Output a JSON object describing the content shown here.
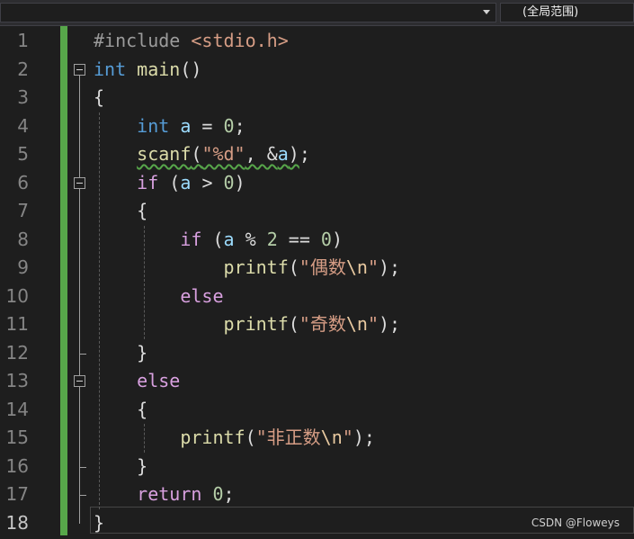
{
  "toolbar": {
    "scope_label": "(全局范围)"
  },
  "editor": {
    "current_line": 18,
    "lines": [
      {
        "n": "1",
        "tokens": [
          {
            "t": "#include ",
            "c": "pp"
          },
          {
            "t": "<stdio.h>",
            "c": "inc"
          }
        ]
      },
      {
        "n": "2",
        "tokens": [
          {
            "t": "int",
            "c": "kw"
          },
          {
            "t": " ",
            "c": ""
          },
          {
            "t": "main",
            "c": "fn"
          },
          {
            "t": "()",
            "c": ""
          }
        ]
      },
      {
        "n": "3",
        "tokens": [
          {
            "t": "{",
            "c": ""
          }
        ]
      },
      {
        "n": "4",
        "tokens": [
          {
            "t": "    ",
            "c": ""
          },
          {
            "t": "int",
            "c": "kw"
          },
          {
            "t": " ",
            "c": ""
          },
          {
            "t": "a",
            "c": "var"
          },
          {
            "t": " = ",
            "c": ""
          },
          {
            "t": "0",
            "c": "num"
          },
          {
            "t": ";",
            "c": ""
          }
        ]
      },
      {
        "n": "5",
        "tokens": [
          {
            "t": "    ",
            "c": ""
          },
          {
            "t": "scanf",
            "c": "fn squig"
          },
          {
            "t": "(",
            "c": "squig"
          },
          {
            "t": "\"%d\"",
            "c": "str squig"
          },
          {
            "t": ", &",
            "c": "squig"
          },
          {
            "t": "a",
            "c": "var squig"
          },
          {
            "t": ")",
            "c": "squig"
          },
          {
            "t": ";",
            "c": ""
          }
        ]
      },
      {
        "n": "6",
        "tokens": [
          {
            "t": "    ",
            "c": ""
          },
          {
            "t": "if",
            "c": "ctl"
          },
          {
            "t": " (",
            "c": ""
          },
          {
            "t": "a",
            "c": "var"
          },
          {
            "t": " > ",
            "c": ""
          },
          {
            "t": "0",
            "c": "num"
          },
          {
            "t": ")",
            "c": ""
          }
        ]
      },
      {
        "n": "7",
        "tokens": [
          {
            "t": "    {",
            "c": ""
          }
        ]
      },
      {
        "n": "8",
        "tokens": [
          {
            "t": "        ",
            "c": ""
          },
          {
            "t": "if",
            "c": "ctl"
          },
          {
            "t": " (",
            "c": ""
          },
          {
            "t": "a",
            "c": "var"
          },
          {
            "t": " % ",
            "c": ""
          },
          {
            "t": "2",
            "c": "num"
          },
          {
            "t": " == ",
            "c": ""
          },
          {
            "t": "0",
            "c": "num"
          },
          {
            "t": ")",
            "c": ""
          }
        ]
      },
      {
        "n": "9",
        "tokens": [
          {
            "t": "            ",
            "c": ""
          },
          {
            "t": "printf",
            "c": "fn"
          },
          {
            "t": "(",
            "c": ""
          },
          {
            "t": "\"偶数",
            "c": "str"
          },
          {
            "t": "\\n",
            "c": "esc"
          },
          {
            "t": "\"",
            "c": "str"
          },
          {
            "t": ");",
            "c": ""
          }
        ]
      },
      {
        "n": "10",
        "tokens": [
          {
            "t": "        ",
            "c": ""
          },
          {
            "t": "else",
            "c": "ctl"
          }
        ]
      },
      {
        "n": "11",
        "tokens": [
          {
            "t": "            ",
            "c": ""
          },
          {
            "t": "printf",
            "c": "fn"
          },
          {
            "t": "(",
            "c": ""
          },
          {
            "t": "\"奇数",
            "c": "str"
          },
          {
            "t": "\\n",
            "c": "esc"
          },
          {
            "t": "\"",
            "c": "str"
          },
          {
            "t": ");",
            "c": ""
          }
        ]
      },
      {
        "n": "12",
        "tokens": [
          {
            "t": "    }",
            "c": ""
          }
        ]
      },
      {
        "n": "13",
        "tokens": [
          {
            "t": "    ",
            "c": ""
          },
          {
            "t": "else",
            "c": "ctl"
          }
        ]
      },
      {
        "n": "14",
        "tokens": [
          {
            "t": "    {",
            "c": ""
          }
        ]
      },
      {
        "n": "15",
        "tokens": [
          {
            "t": "        ",
            "c": ""
          },
          {
            "t": "printf",
            "c": "fn"
          },
          {
            "t": "(",
            "c": ""
          },
          {
            "t": "\"非正数",
            "c": "str"
          },
          {
            "t": "\\n",
            "c": "esc"
          },
          {
            "t": "\"",
            "c": "str"
          },
          {
            "t": ");",
            "c": ""
          }
        ]
      },
      {
        "n": "16",
        "tokens": [
          {
            "t": "    }",
            "c": ""
          }
        ]
      },
      {
        "n": "17",
        "tokens": [
          {
            "t": "    ",
            "c": ""
          },
          {
            "t": "return",
            "c": "ctl"
          },
          {
            "t": " ",
            "c": ""
          },
          {
            "t": "0",
            "c": "num"
          },
          {
            "t": ";",
            "c": ""
          }
        ]
      },
      {
        "n": "18",
        "tokens": [
          {
            "t": "}",
            "c": ""
          }
        ]
      }
    ],
    "fold_lines": [
      2,
      6,
      13
    ]
  },
  "watermark": "CSDN @Floweys"
}
